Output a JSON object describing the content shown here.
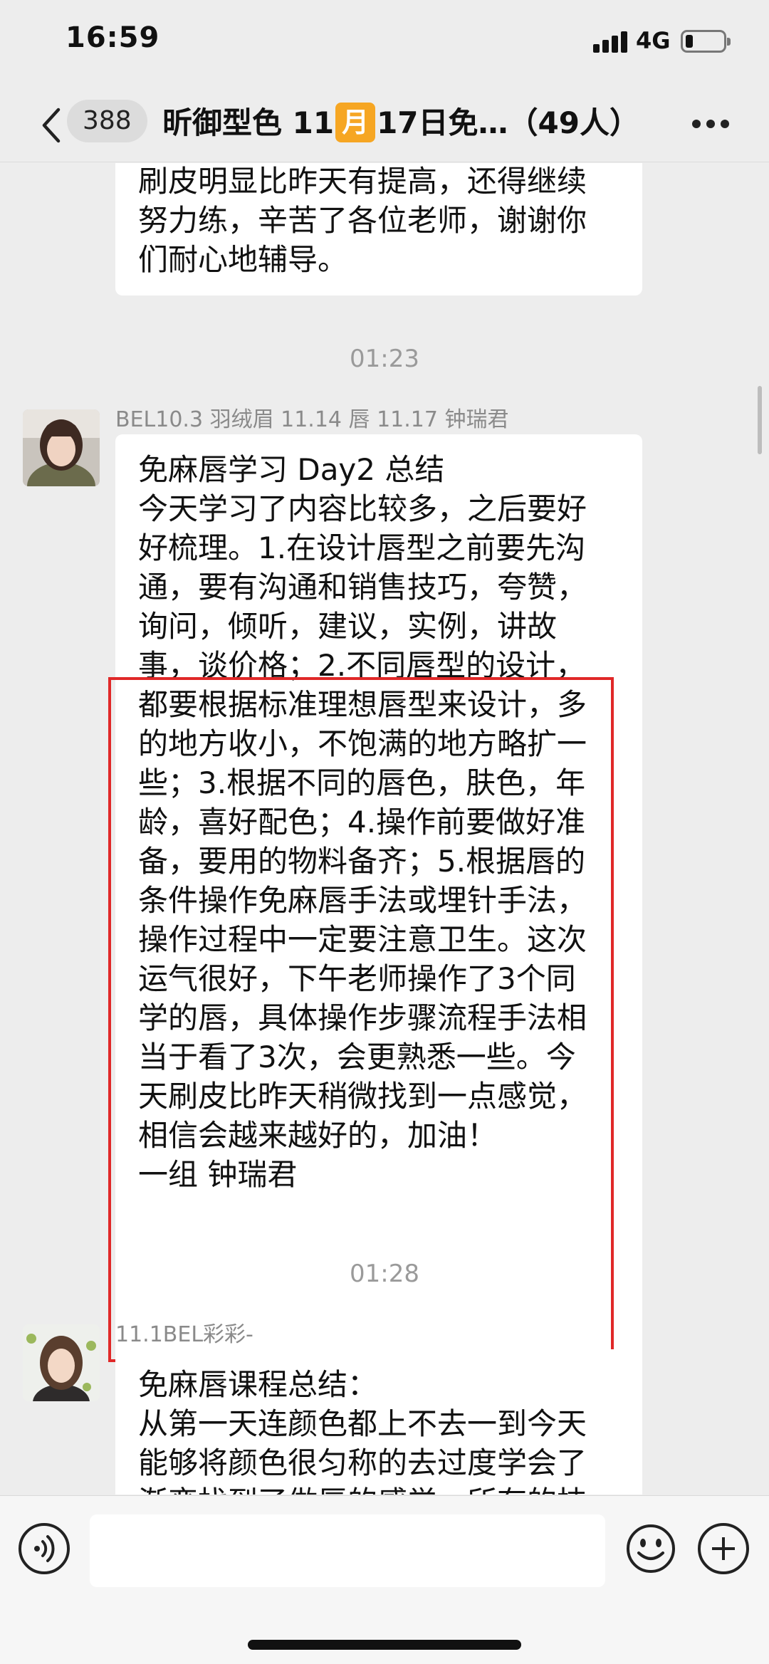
{
  "status_bar": {
    "time": "16:59",
    "network": "4G",
    "battery_level": 0.2
  },
  "nav": {
    "unread_count": "388",
    "title_before": "昕御型色 11",
    "title_month": "月",
    "title_after": "17日免…（49人）",
    "back_icon": "chevron-left-icon",
    "more_icon": "more-dots-icon"
  },
  "messages": [
    {
      "text": "刷皮明显比昨天有提高，还得继续\n努力练，辛苦了各位老师，谢谢你\n们耐心地辅导。"
    },
    {
      "time": "01:23",
      "sender": "BEL10.3 羽绒眉 11.14 唇 11.17 钟瑞君",
      "text": "免麻唇学习 Day2 总结\n今天学习了内容比较多，之后要好\n好梳理。1.在设计唇型之前要先沟\n通，要有沟通和销售技巧，夸赞，\n询问，倾听，建议，实例，讲故\n事，谈价格；2.不同唇型的设计，\n都要根据标准理想唇型来设计，多\n的地方收小，不饱满的地方略扩一\n些；3.根据不同的唇色，肤色，年\n龄，喜好配色；4.操作前要做好准\n备，要用的物料备齐；5.根据唇的\n条件操作免麻唇手法或埋针手法，\n操作过程中一定要注意卫生。这次\n运气很好，下午老师操作了3个同\n学的唇，具体操作步骤流程手法相\n当于看了3次，会更熟悉一些。今\n天刷皮比昨天稍微找到一点感觉，\n相信会越来越好的，加油！\n一组 钟瑞君"
    },
    {
      "time": "01:28",
      "sender": "11.1BEL彩彩-",
      "text": "免麻唇课程总结：\n从第一天连颜色都上不去一到今天\n能够将颜色很匀称的去过度学会了\n渐变找到了做唇的感觉，所有的技"
    }
  ],
  "input_bar": {
    "voice_icon": "voice-icon",
    "emoji_icon": "emoji-icon",
    "plus_icon": "plus-icon",
    "placeholder": ""
  }
}
